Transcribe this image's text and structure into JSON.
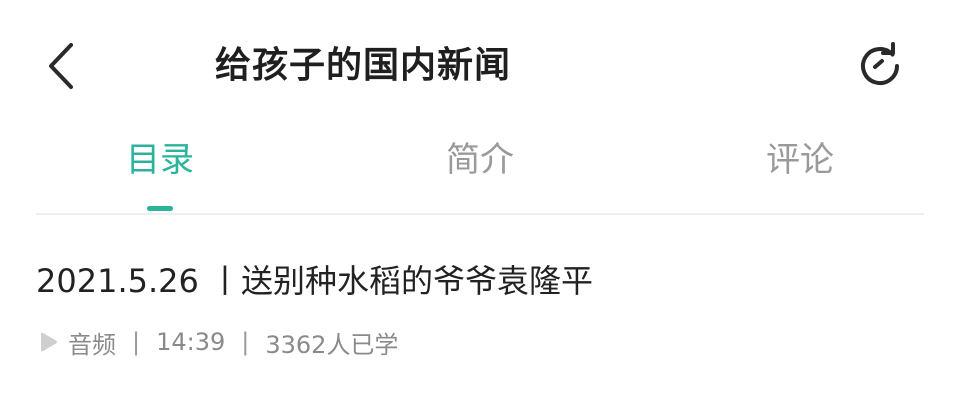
{
  "header": {
    "back_icon": "chevron-left-icon",
    "title": "给孩子的国内新闻",
    "refresh_icon": "refresh-icon"
  },
  "tabs": [
    {
      "label": "目录",
      "active": true
    },
    {
      "label": "简介",
      "active": false
    },
    {
      "label": "评论",
      "active": false
    }
  ],
  "colors": {
    "accent": "#2bb39c",
    "tab_inactive": "#9a9a9a",
    "text_primary": "#222222",
    "text_secondary": "#8a8a8a"
  },
  "items": [
    {
      "title": "2021.5.26 丨送别种水稻的爷爷袁隆平",
      "meta": {
        "type_icon": "audio-play-icon",
        "type": "音频",
        "duration": "14:39",
        "learners": "3362人已学",
        "separator": "|"
      }
    }
  ]
}
